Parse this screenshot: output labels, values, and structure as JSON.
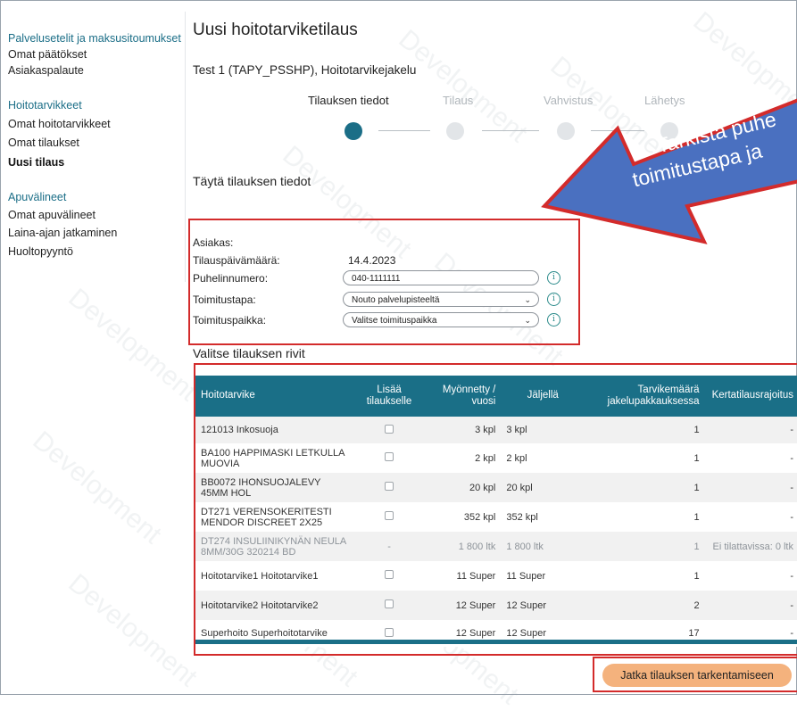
{
  "sidebar": {
    "section1": {
      "heading": "Palvelusetelit ja maksusitoumukset",
      "items": [
        "Omat päätökset",
        "Asiakaspalaute"
      ]
    },
    "section2": {
      "heading": "Hoitotarvikkeet",
      "items": [
        "Omat hoitotarvikkeet",
        "Omat tilaukset",
        "Uusi tilaus"
      ]
    },
    "section3": {
      "heading": "Apuvälineet",
      "items": [
        "Omat apuvälineet",
        "Laina-ajan jatkaminen",
        "Huoltopyyntö"
      ]
    }
  },
  "page": {
    "title": "Uusi hoitotarviketilaus",
    "subtitle": "Test 1 (TAPY_PSSHP), Hoitotarvikejakelu"
  },
  "steps": [
    "Tilauksen tiedot",
    "Tilaus",
    "Vahvistus",
    "Lähetys"
  ],
  "form": {
    "section_title": "Täytä tilauksen tiedot",
    "customer_label": "Asiakas:",
    "date_label": "Tilauspäivämäärä:",
    "date_value": "14.4.2023",
    "phone_label": "Puhelinnumero:",
    "phone_value": "040-1111111",
    "delivery_label": "Toimitustapa:",
    "delivery_value": "Nouto palvelupisteeltä",
    "place_label": "Toimituspaikka:",
    "place_value": "Valitse toimituspaikka"
  },
  "table": {
    "section_title": "Valitse tilauksen rivit",
    "headers": {
      "name": "Hoitotarvike",
      "add": "Lisää tilaukselle",
      "granted": "Myönnetty / vuosi",
      "remaining": "Jäljellä",
      "pack": "Tarvikemäärä jakelupakkauksessa",
      "limit": "Kertatilausrajoitus"
    },
    "rows": [
      {
        "name": "121013 Inkosuoja",
        "add": "",
        "granted": "3 kpl",
        "remaining": "3 kpl",
        "pack": "1",
        "limit": "-"
      },
      {
        "name": "BA100 HAPPIMASKI LETKULLA MUOVIA",
        "add": "",
        "granted": "2 kpl",
        "remaining": "2 kpl",
        "pack": "1",
        "limit": "-"
      },
      {
        "name": "BB0072 IHONSUOJALEVY 45MM HOL",
        "add": "",
        "granted": "20 kpl",
        "remaining": "20 kpl",
        "pack": "1",
        "limit": "-"
      },
      {
        "name": "DT271 VERENSOKERITESTI MENDOR DISCREET 2X25",
        "add": "",
        "granted": "352 kpl",
        "remaining": "352 kpl",
        "pack": "1",
        "limit": "-"
      },
      {
        "name": "DT274 INSULIINIKYNÄN NEULA 8MM/30G 320214 BD",
        "add": "-",
        "granted": "1 800 ltk",
        "remaining": "1 800 ltk",
        "pack": "1",
        "limit": "Ei tilattavissa: 0 ltk"
      },
      {
        "name": "Hoitotarvike1 Hoitotarvike1",
        "add": "",
        "granted": "11 Super",
        "remaining": "11 Super",
        "pack": "1",
        "limit": "-"
      },
      {
        "name": "Hoitotarvike2 Hoitotarvike2",
        "add": "",
        "granted": "12 Super",
        "remaining": "12 Super",
        "pack": "2",
        "limit": "-"
      },
      {
        "name": "Superhoito Superhoitotarvike",
        "add": "",
        "granted": "12 Super",
        "remaining": "12 Super",
        "pack": "17",
        "limit": "-"
      }
    ]
  },
  "actions": {
    "continue_label": "Jatka tilauksen tarkentamiseen"
  },
  "callout": {
    "line1": "Tarkista puhe",
    "line2": "toimitustapa ja"
  },
  "watermark": "Development",
  "colors": {
    "accent": "#1a6f87",
    "active_step": "#1b6e87",
    "highlight_border": "#d32b2b",
    "callout_fill": "#4a70c0",
    "callout_border": "#d32b2b",
    "button": "#f4b27d"
  }
}
